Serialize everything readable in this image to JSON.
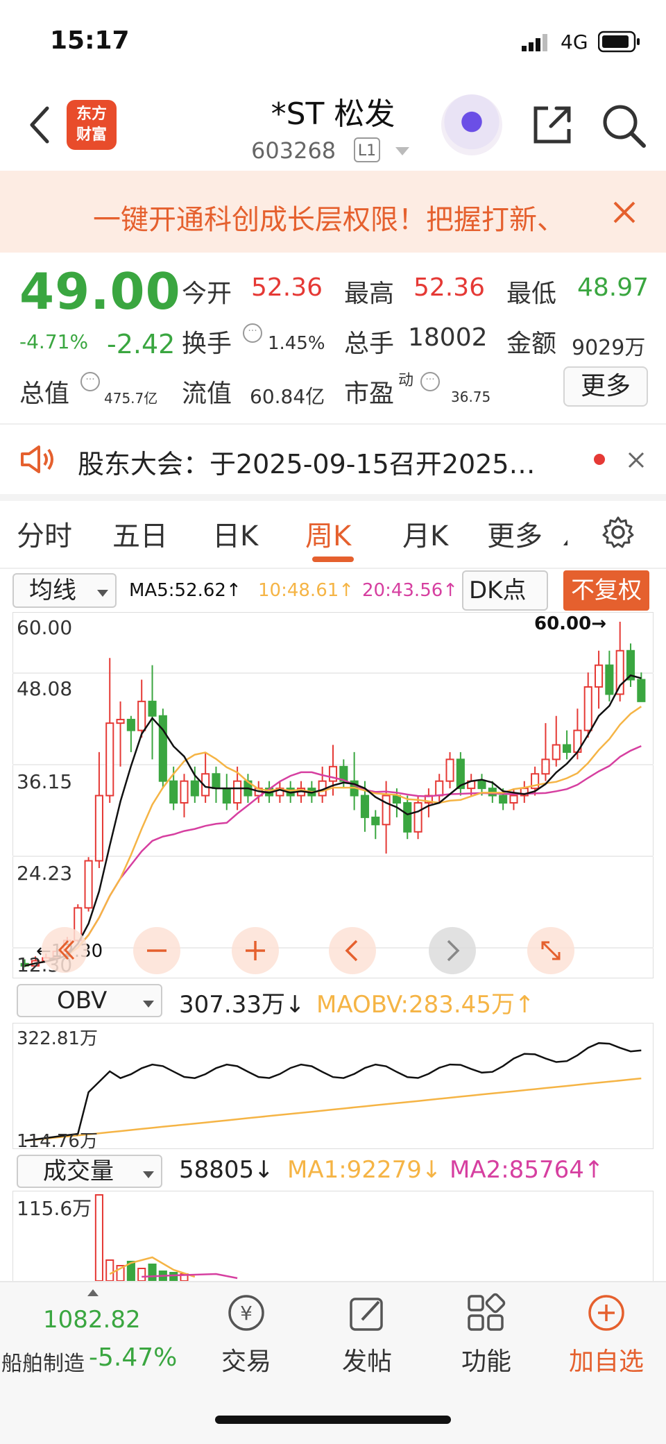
{
  "status": {
    "time": "15:17",
    "network": "4G"
  },
  "header": {
    "title": "*ST 松发",
    "code": "603268",
    "level": "L1",
    "logo_line1": "东方",
    "logo_line2": "财富"
  },
  "banner": {
    "text": "一键开通科创成长层权限！把握打新、"
  },
  "quote": {
    "price": "49.00",
    "change_pct": "-4.71%",
    "change": "-2.42",
    "open_label": "今开",
    "open": "52.36",
    "high_label": "最高",
    "high": "52.36",
    "low_label": "最低",
    "low": "48.97",
    "turnover_label": "换手",
    "turnover": "1.45%",
    "volume_label": "总手",
    "volume": "18002",
    "amount_label": "金额",
    "amount": "9029万",
    "mktcap_label": "总值",
    "mktcap": "475.7亿",
    "float_label": "流值",
    "float_cap": "60.84亿",
    "pe_label": "市盈",
    "pe_sup": "动",
    "pe": "36.75",
    "more": "更多"
  },
  "notice": {
    "text": "股东大会：于2025-09-15召开2025…"
  },
  "tabs": [
    "分时",
    "五日",
    "日K",
    "周K",
    "月K",
    "更多"
  ],
  "chart": {
    "indicator": "均线",
    "ma5": "MA5:52.62↑",
    "ma10": "10:48.61↑",
    "ma20": "20:43.56↑",
    "dk": "DK点",
    "adjust": "不复权",
    "y_ticks": [
      "60.00",
      "48.08",
      "36.15",
      "24.23",
      "12.30"
    ],
    "max_label": "60.00→",
    "min_label": "←12.30",
    "obv_select": "OBV",
    "obv_val": "307.33万↓",
    "maobv": "MAOBV:283.45万↑",
    "obv_top": "322.81万",
    "obv_bottom": "114.76万",
    "vol_select": "成交量",
    "vol_val": "58805↓",
    "vol_ma1": "MA1:92279↓",
    "vol_ma2": "MA2:85764↑",
    "vol_top": "115.6万",
    "colors": {
      "up": "#e53935",
      "down": "#3aa640",
      "ma5": "#111111",
      "ma10": "#f5b445",
      "ma20": "#d63fa0"
    }
  },
  "bottom": {
    "index_value": "1082.82",
    "index_name": "船舶制造",
    "index_pct": "-5.47%",
    "trade": "交易",
    "post": "发帖",
    "func": "功能",
    "watch": "加自选"
  }
}
